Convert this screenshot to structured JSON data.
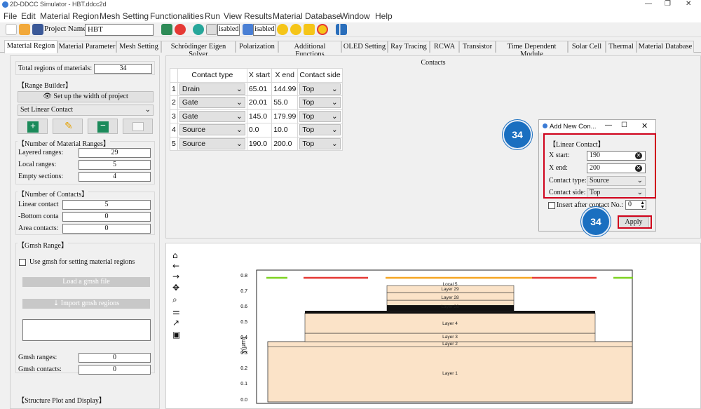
{
  "window": {
    "title": "2D-DDCC Simulator - HBT.ddcc2d",
    "minimize": "—",
    "restore": "❐",
    "close": "✕"
  },
  "menu": [
    "File",
    "Edit",
    "Material Region",
    "Mesh Setting",
    "Functionalities",
    "Run",
    "View Results",
    "Material Database",
    "Window",
    "Help"
  ],
  "toolbar": {
    "project_label": "Project Name:",
    "project_name": "HBT",
    "disabled1": "isabled",
    "disabled2": "isabled"
  },
  "tabs": [
    "Material Region",
    "Material Parameter",
    "Mesh Setting",
    "Schrödinger Eigen Solver",
    "Polarization",
    "Additional Functions",
    "OLED Setting",
    "Ray Tracing",
    "RCWA",
    "Transistor",
    "Time Dependent Module",
    "Solar Cell",
    "Thermal",
    "Material Database"
  ],
  "left": {
    "total_regions_label": "Total regions of materials:",
    "total_regions": "34",
    "range_builder": "【Range Builder】",
    "setup_width": "Set up the width of project",
    "set_linear_contact": "Set Linear Contact",
    "num_ranges_title": "【Number of Material Ranges】",
    "layered_label": "Layered ranges:",
    "layered": "29",
    "local_label": "Local ranges:",
    "local": "5",
    "empty_label": "Empty sections:",
    "empty": "4",
    "num_contacts_title": "【Number of Contacts】",
    "linear_label": "Linear contact",
    "linear": "5",
    "bottom_label": "-Bottom conta",
    "bottom": "0",
    "area_label": "Area contacts:",
    "area": "0",
    "gmsh_title": "【Gmsh Range】",
    "use_gmsh": "Use gmsh for setting material regions",
    "load_gmsh": "Load a gmsh file",
    "import_gmsh": "Import gmsh regions",
    "gmsh_ranges_label": "Gmsh ranges:",
    "gmsh_ranges": "0",
    "gmsh_contacts_label": "Gmsh contacts:",
    "gmsh_contacts": "0",
    "structure_title": "【Structure Plot and Display】"
  },
  "contacts": {
    "title": "Contacts",
    "headers": [
      "Contact type",
      "X start",
      "X end",
      "Contact side"
    ],
    "rows": [
      {
        "n": "1",
        "type": "Drain",
        "xs": "65.01",
        "xe": "144.99",
        "side": "Top"
      },
      {
        "n": "2",
        "type": "Gate",
        "xs": "20.01",
        "xe": "55.0",
        "side": "Top"
      },
      {
        "n": "3",
        "type": "Gate",
        "xs": "145.0",
        "xe": "179.99",
        "side": "Top"
      },
      {
        "n": "4",
        "type": "Source",
        "xs": "0.0",
        "xe": "10.0",
        "side": "Top"
      },
      {
        "n": "5",
        "type": "Source",
        "xs": "190.0",
        "xe": "200.0",
        "side": "Top"
      }
    ]
  },
  "dialog": {
    "title": "Add New Con...",
    "group": "【Linear Contact】",
    "xstart_label": "X start:",
    "xstart": "190",
    "xend_label": "X end:",
    "xend": "200",
    "ctype_label": "Contact type:",
    "ctype": "Source",
    "cside_label": "Contact side:",
    "cside": "Top",
    "insert_label": "Insert after contact No.:",
    "insert_no": "0",
    "apply": "Apply"
  },
  "badges": {
    "b1": "34",
    "b2": "34"
  },
  "plot": {
    "ylabel": "y(μm)",
    "yticks": [
      "0.8",
      "0.7",
      "0.6",
      "0.5",
      "0.4",
      "0.3",
      "0.2",
      "0.1",
      "0.0"
    ],
    "layers": [
      "Local 5",
      "Layer 29",
      "Layer 28",
      "Layer 26",
      "Layer 4",
      "Layer 3",
      "Layer 2",
      "Layer 1"
    ]
  },
  "colors": {
    "accent": "#1a6fc0",
    "highlight": "#d0021b",
    "layer_fill": "#fbe3c8",
    "gate": "#e53935",
    "drain": "#f5a623",
    "source": "#7ed321"
  }
}
